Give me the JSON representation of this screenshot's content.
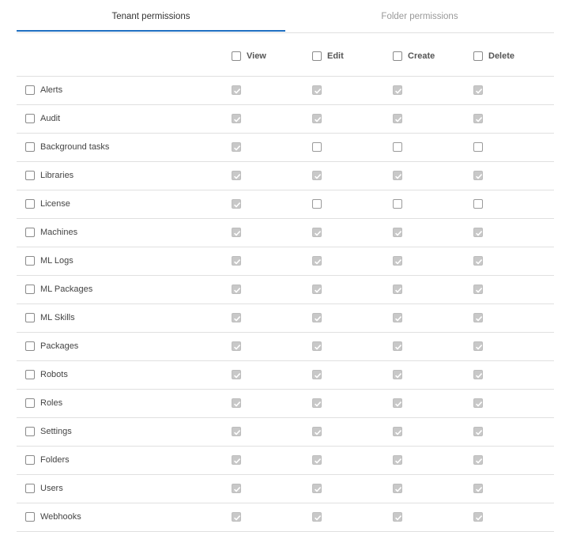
{
  "tabs": [
    {
      "label": "Tenant permissions",
      "active": true
    },
    {
      "label": "Folder permissions",
      "active": false
    }
  ],
  "columns": [
    "View",
    "Edit",
    "Create",
    "Delete"
  ],
  "rows": [
    {
      "label": "Alerts",
      "perms": [
        true,
        true,
        true,
        true
      ]
    },
    {
      "label": "Audit",
      "perms": [
        true,
        true,
        true,
        true
      ]
    },
    {
      "label": "Background tasks",
      "perms": [
        true,
        false,
        false,
        false
      ]
    },
    {
      "label": "Libraries",
      "perms": [
        true,
        true,
        true,
        true
      ]
    },
    {
      "label": "License",
      "perms": [
        true,
        false,
        false,
        false
      ]
    },
    {
      "label": "Machines",
      "perms": [
        true,
        true,
        true,
        true
      ]
    },
    {
      "label": "ML Logs",
      "perms": [
        true,
        true,
        true,
        true
      ]
    },
    {
      "label": "ML Packages",
      "perms": [
        true,
        true,
        true,
        true
      ]
    },
    {
      "label": "ML Skills",
      "perms": [
        true,
        true,
        true,
        true
      ]
    },
    {
      "label": "Packages",
      "perms": [
        true,
        true,
        true,
        true
      ]
    },
    {
      "label": "Robots",
      "perms": [
        true,
        true,
        true,
        true
      ]
    },
    {
      "label": "Roles",
      "perms": [
        true,
        true,
        true,
        true
      ]
    },
    {
      "label": "Settings",
      "perms": [
        true,
        true,
        true,
        true
      ]
    },
    {
      "label": "Folders",
      "perms": [
        true,
        true,
        true,
        true
      ]
    },
    {
      "label": "Users",
      "perms": [
        true,
        true,
        true,
        true
      ]
    },
    {
      "label": "Webhooks",
      "perms": [
        true,
        true,
        true,
        true
      ]
    }
  ],
  "colors": {
    "accent": "#1f6fc1",
    "checked_fill": "#c8c8c8",
    "border": "#e0e0e0"
  }
}
